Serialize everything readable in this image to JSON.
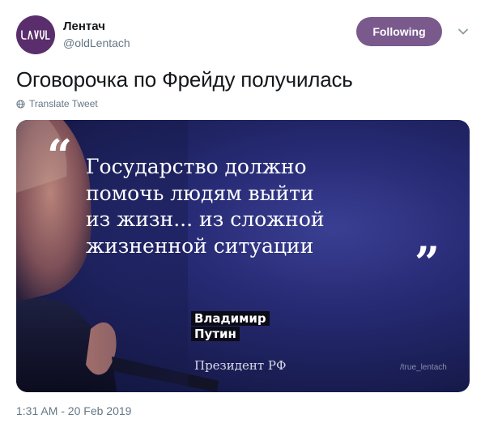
{
  "header": {
    "display_name": "Лентач",
    "handle": "@oldLentach",
    "follow_label": "Following",
    "follow_color": "#7a5a8d",
    "avatar_color": "#5a2d6d",
    "avatar_icon": "lentach-logo-icon",
    "menu_icon": "chevron-down-icon"
  },
  "tweet": {
    "text": "Оговорочка по Фрейду получилась",
    "translate_label": "Translate Tweet",
    "translate_icon": "globe-icon",
    "timestamp": "1:31 AM - 20 Feb 2019"
  },
  "media": {
    "quote_open": "“",
    "quote_close": "”",
    "quote_text": "Государство должно\nпомочь людям выйти\nиз жизн... из сложной\nжизненной ситуации",
    "author_first": "Владимир",
    "author_last": "Путин",
    "author_title": "Президент РФ",
    "watermark": "/true_lentach",
    "background_color": "#262a73"
  }
}
